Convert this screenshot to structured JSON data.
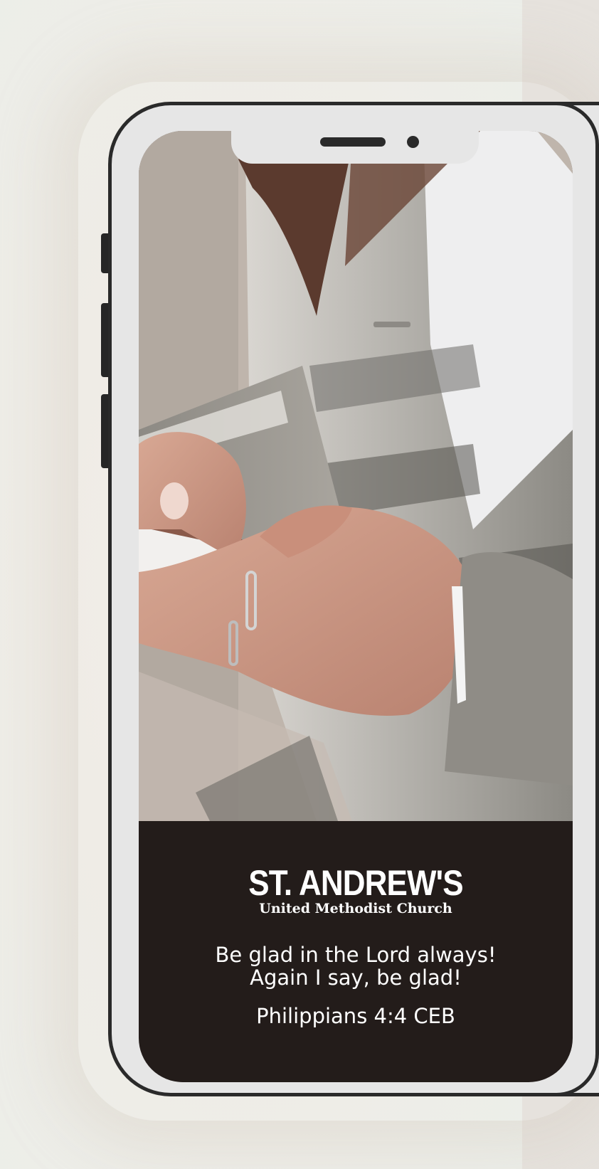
{
  "church": {
    "name": "ST. ANDREW'S",
    "subtitle": "United Methodist Church"
  },
  "message": {
    "line1": "Be glad in the Lord always!",
    "line2": "Again I say, be glad!",
    "reference": "Philippians 4:4 CEB"
  },
  "colors": {
    "caption_background": "#231c1a",
    "phone_frame": "#2a2a2a",
    "phone_body": "#e6e6e6",
    "text": "#ffffff"
  },
  "image": {
    "subject": "hands-typing-on-smartphone-photo"
  }
}
